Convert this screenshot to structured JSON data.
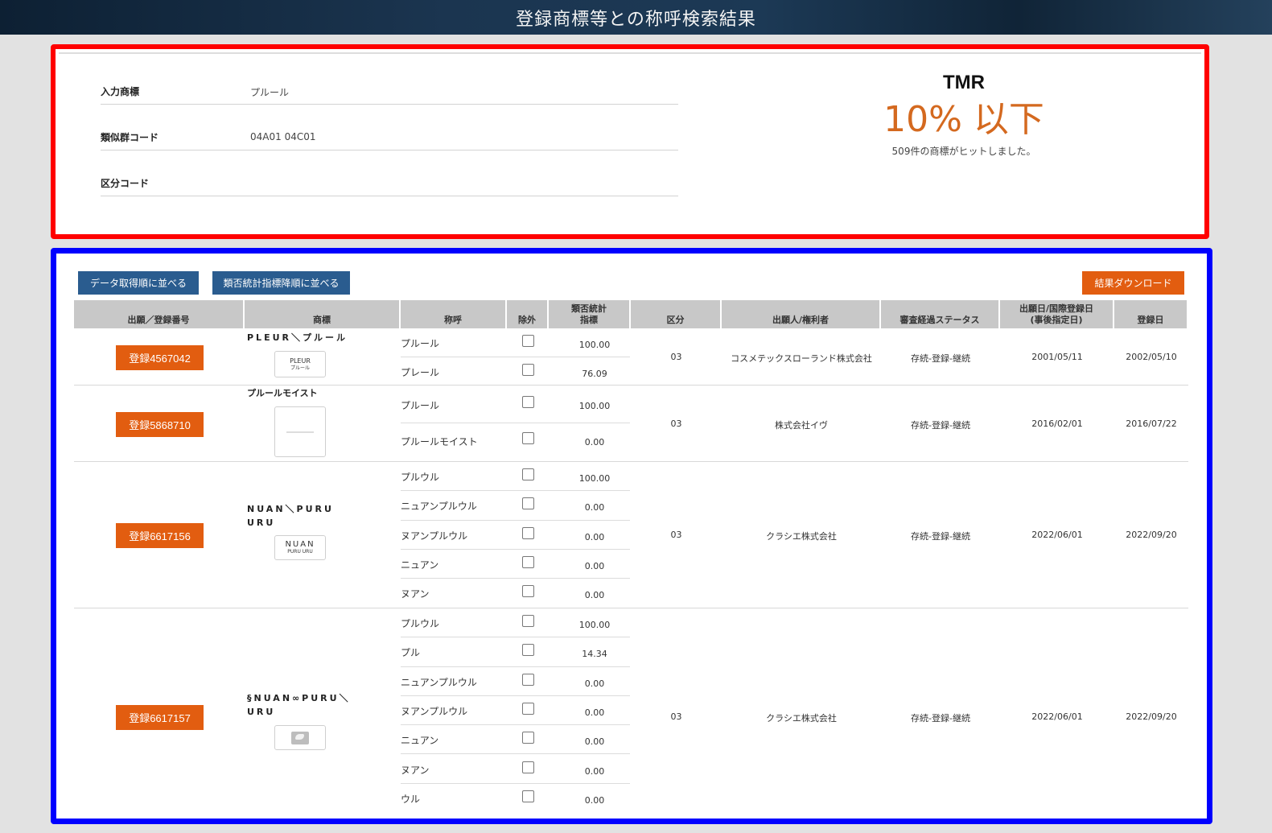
{
  "page": {
    "title": "登録商標等との称呼検索結果"
  },
  "summary": {
    "rows": [
      {
        "label": "入力商標",
        "value": "プルール"
      },
      {
        "label": "類似群コード",
        "value": "04A01 04C01"
      },
      {
        "label": "区分コード",
        "value": ""
      }
    ],
    "brand": "TMR",
    "percentage": "10% 以下",
    "hit_text": "509件の商標がヒットしました。"
  },
  "toolbar": {
    "sort_by_data": "データ取得順に並べる",
    "sort_by_index": "類否統計指標降順に並べる",
    "download": "結果ダウンロード"
  },
  "columns": [
    "出願／登録番号",
    "商標",
    "称呼",
    "除外",
    "類否統計\n指標",
    "区分",
    "出願人/権利者",
    "審査経過ステータス",
    "出願日/国際登録日\n(事後指定日)",
    "登録日"
  ],
  "results": [
    {
      "number": "登録4567042",
      "mark": "PLEUR＼プルール",
      "logo_lines": [
        "PLEUR",
        "プルール"
      ],
      "yomi": [
        {
          "text": "プルール",
          "score": "100.00",
          "excluded": false
        },
        {
          "text": "プレール",
          "score": "76.09",
          "excluded": false
        }
      ],
      "class": "03",
      "applicant": "コスメテックスローランド株式会社",
      "status": "存続-登録-継続",
      "filed": "2001/05/11",
      "registered": "2002/05/10"
    },
    {
      "number": "登録5868710",
      "mark": "プルールモイスト",
      "logo_lines": [],
      "yomi": [
        {
          "text": "プルール",
          "score": "100.00",
          "excluded": false
        },
        {
          "text": "プルールモイスト",
          "score": "0.00",
          "excluded": false
        }
      ],
      "class": "03",
      "applicant": "株式会社イヴ",
      "status": "存続-登録-継続",
      "filed": "2016/02/01",
      "registered": "2016/07/22"
    },
    {
      "number": "登録6617156",
      "mark": "NUAN＼PURU　URU",
      "logo_lines": [
        "NUAN",
        "PURU URU"
      ],
      "yomi": [
        {
          "text": "プルウル",
          "score": "100.00",
          "excluded": false
        },
        {
          "text": "ニュアンプルウル",
          "score": "0.00",
          "excluded": false
        },
        {
          "text": "ヌアンプルウル",
          "score": "0.00",
          "excluded": false
        },
        {
          "text": "ニュアン",
          "score": "0.00",
          "excluded": false
        },
        {
          "text": "ヌアン",
          "score": "0.00",
          "excluded": false
        }
      ],
      "class": "03",
      "applicant": "クラシエ株式会社",
      "status": "存続-登録-継続",
      "filed": "2022/06/01",
      "registered": "2022/09/20"
    },
    {
      "number": "登録6617157",
      "mark": "§NUAN∞PURU＼URU",
      "logo_lines": [],
      "yomi": [
        {
          "text": "プルウル",
          "score": "100.00",
          "excluded": false
        },
        {
          "text": "プル",
          "score": "14.34",
          "excluded": false
        },
        {
          "text": "ニュアンプルウル",
          "score": "0.00",
          "excluded": false
        },
        {
          "text": "ヌアンプルウル",
          "score": "0.00",
          "excluded": false
        },
        {
          "text": "ニュアン",
          "score": "0.00",
          "excluded": false
        },
        {
          "text": "ヌアン",
          "score": "0.00",
          "excluded": false
        },
        {
          "text": "ウル",
          "score": "0.00",
          "excluded": false
        }
      ],
      "class": "03",
      "applicant": "クラシエ株式会社",
      "status": "存続-登録-継続",
      "filed": "2022/06/01",
      "registered": "2022/09/20"
    }
  ],
  "colors": {
    "accent": "#e25d10",
    "primary": "#2a5c8f",
    "percent": "#d4691f"
  }
}
